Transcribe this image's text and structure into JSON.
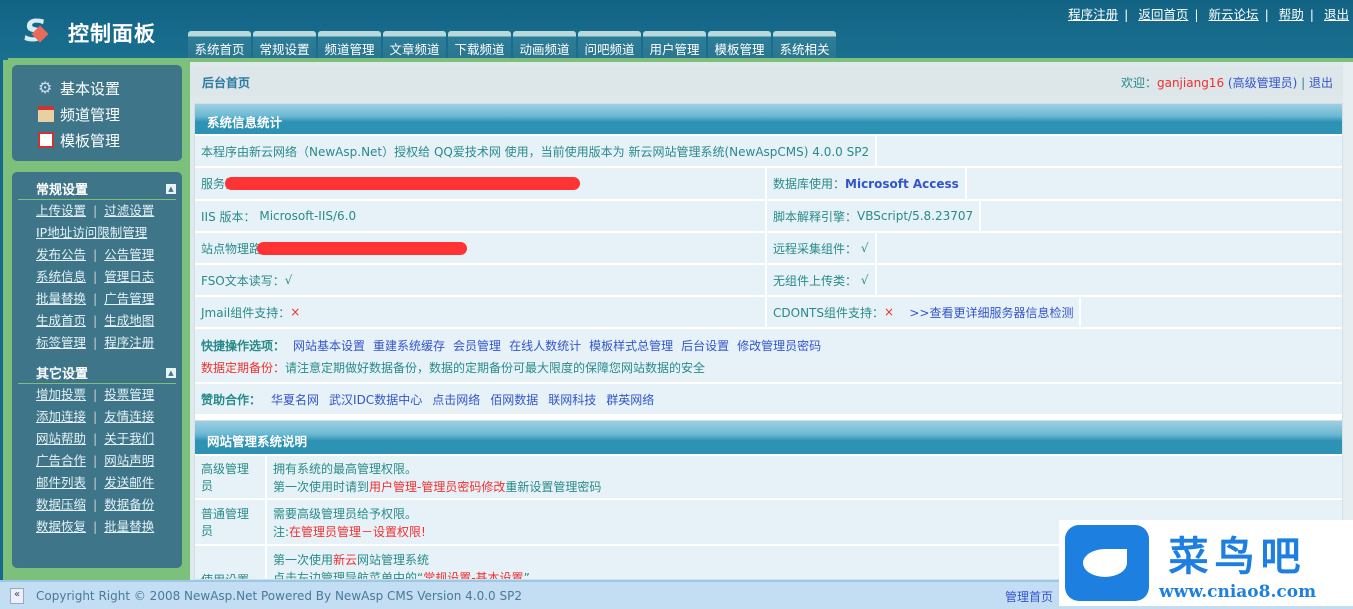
{
  "header": {
    "title": "控制面板",
    "toplinks": [
      "程序注册",
      "返回首页",
      "新云论坛",
      "帮助",
      "退出"
    ],
    "tabs": [
      "系统首页",
      "常规设置",
      "频道管理",
      "文章频道",
      "下载频道",
      "动画频道",
      "问吧频道",
      "用户管理",
      "模板管理",
      "系统相关"
    ]
  },
  "sidebar": {
    "quick": [
      "基本设置",
      "频道管理",
      "模板管理"
    ],
    "groups": [
      {
        "title": "常规设置",
        "rows": [
          [
            "上传设置",
            "过滤设置"
          ],
          [
            "IP地址访问限制管理"
          ],
          [
            "发布公告",
            "公告管理"
          ],
          [
            "系统信息",
            "管理日志"
          ],
          [
            "批量替换",
            "广告管理"
          ],
          [
            "生成首页",
            "生成地图"
          ],
          [
            "标签管理",
            "程序注册"
          ]
        ]
      },
      {
        "title": "其它设置",
        "rows": [
          [
            "增加投票",
            "投票管理"
          ],
          [
            "添加连接",
            "友情连接"
          ],
          [
            "网站帮助",
            "关于我们"
          ],
          [
            "广告合作",
            "网站声明"
          ],
          [
            "邮件列表",
            "发送邮件"
          ],
          [
            "数据压缩",
            "数据备份"
          ],
          [
            "数据恢复",
            "批量替换"
          ]
        ]
      }
    ]
  },
  "crumb": {
    "title": "后台首页",
    "welcome": "欢迎：",
    "user": "ganjiang16",
    "role": "(高级管理员)",
    "sep": "|",
    "logout": "退出"
  },
  "info": {
    "title": "系统信息统计",
    "license": "本程序由新云网络（NewAsp.Net）授权给 QQ爱技术网 使用，当前使用版本为 新云网站管理系统(NewAspCMS) 4.0.0 SP2",
    "server_label": "服务器",
    "db_label": "数据库使用：",
    "db_value": "Microsoft Access",
    "iis_label": "IIS 版本：",
    "iis_value": "Microsoft-IIS/6.0",
    "script_label": "脚本解释引擎：",
    "script_value": "VBScript/5.8.23707",
    "path_label": "站点物理路径",
    "remote_label": "远程采集组件：",
    "remote_value": "√",
    "fso_label": "FSO文本读写：",
    "fso_value": "√",
    "upload_label": "无组件上传类：",
    "upload_value": "√",
    "jmail_label": "Jmail组件支持：",
    "jmail_value": "×",
    "cdonts_label": "CDONTS组件支持：",
    "cdonts_value": "×",
    "detail_link": ">>查看更详细服务器信息检测",
    "quick_label": "快捷操作选项：",
    "quick_links": [
      "网站基本设置",
      "重建系统缓存",
      "会员管理",
      "在线人数统计",
      "模板样式总管理",
      "后台设置",
      "修改管理员密码"
    ],
    "backup_label": "数据定期备份：",
    "backup_text": "请注意定期做好数据备份，数据的定期备份可最大限度的保障您网站数据的安全",
    "sponsor_label": "赞助合作：",
    "sponsors": [
      "华夏名网",
      "武汉IDC数据中心",
      "点击网络",
      "佰网数据",
      "联网科技",
      "群英网络"
    ]
  },
  "guide": {
    "title": "网站管理系统说明",
    "rows": [
      {
        "label": "高级管理员",
        "l1": "拥有系统的最高管理权限。",
        "l2a": "第一次使用时请到",
        "l2b": "用户管理-管理员密码修改",
        "l2c": "重新设置管理密码"
      },
      {
        "label": "普通管理员",
        "l1": "需要高级管理员给予权限。",
        "l2a": "注:",
        "l2b": "在管理员管理－设置权限!"
      },
      {
        "label": "使用设置",
        "l1a": "第一次使用",
        "l1b": "新云",
        "l1c": "网站管理系统",
        "l2a": "点击左边管理导航菜单中的“",
        "l2b": "常规设置-基本设置",
        "l2c": "”"
      }
    ]
  },
  "footer": {
    "copyright": "Copyright Right © 2008 NewAsp.Net Powered By NewAsp CMS Version 4.0.0 SP2",
    "right": "管理首页"
  },
  "watermark": {
    "name": "菜鸟吧",
    "url": "www.cniao8.com"
  },
  "colors": {
    "header": "#16698a",
    "sidebar_border": "#7cc07c",
    "sidebar": "#3e7589",
    "title_bar": "#2e92b4",
    "link": "#3355cc",
    "alert": "#f03030"
  }
}
